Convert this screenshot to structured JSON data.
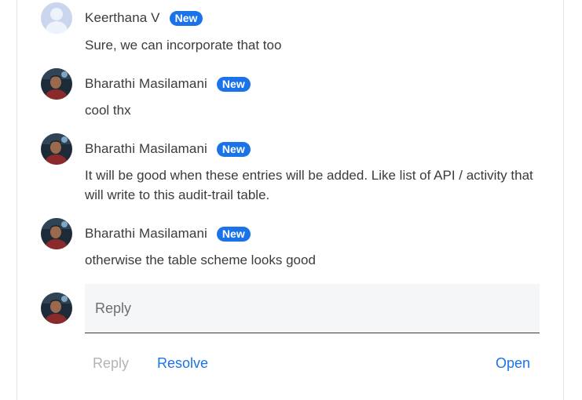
{
  "comments": [
    {
      "author": "Keerthana V",
      "badge": "New",
      "body": "Sure, we can incorporate that too",
      "avatar": "default-person-icon"
    },
    {
      "author": "Bharathi Masilamani",
      "badge": "New",
      "body": "cool thx",
      "avatar": "profile-photo"
    },
    {
      "author": "Bharathi Masilamani",
      "badge": "New",
      "body": "It will be good when these entries will be added. Like list of API / activity that will write to this audit-trail table.",
      "avatar": "profile-photo"
    },
    {
      "author": "Bharathi Masilamani",
      "badge": "New",
      "body": "otherwise the table scheme looks good",
      "avatar": "profile-photo"
    }
  ],
  "reply": {
    "placeholder": "Reply"
  },
  "actions": {
    "reply_label": "Reply",
    "resolve_label": "Resolve",
    "open_label": "Open"
  },
  "colors": {
    "accent": "#1a73e8",
    "text": "#3b3b3b",
    "disabled": "#b3b3b3"
  }
}
